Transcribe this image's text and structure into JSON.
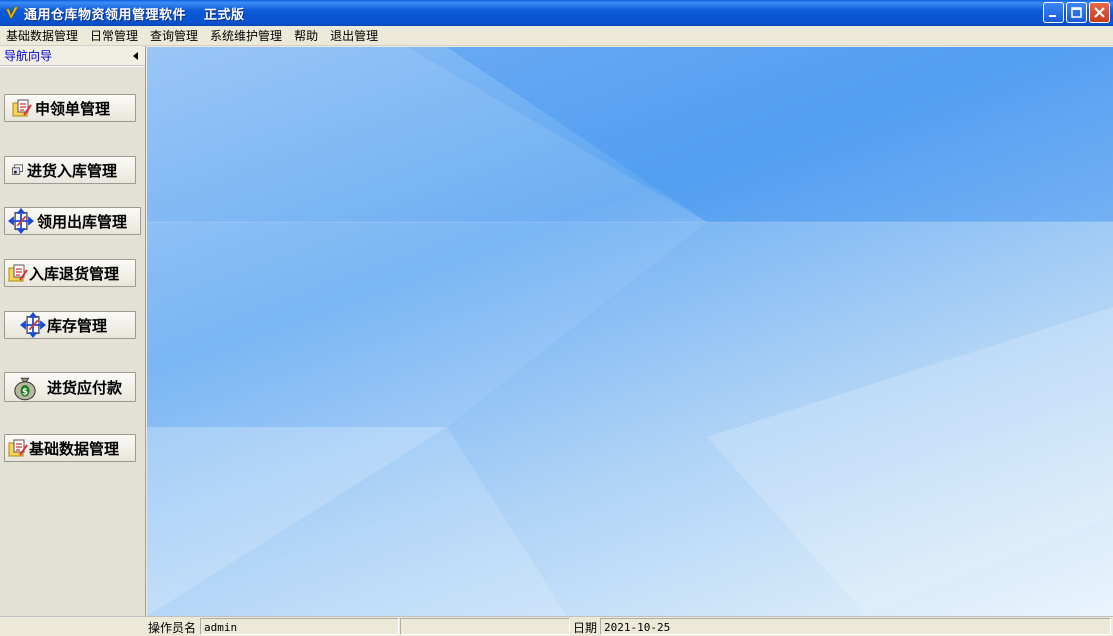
{
  "window": {
    "title": "通用仓库物资领用管理软件",
    "edition": "正式版"
  },
  "menu": {
    "items": [
      "基础数据管理",
      "日常管理",
      "查询管理",
      "系统维护管理",
      "帮助",
      "退出管理"
    ]
  },
  "sidebar": {
    "header": "导航向导",
    "buttons": [
      {
        "label": "申领单管理",
        "icon": "folder-edit-icon"
      },
      {
        "label": "进货入库管理",
        "icon": "cards-icon"
      },
      {
        "label": "领用出库管理",
        "icon": "arrows-cross-icon"
      },
      {
        "label": "入库退货管理",
        "icon": "folder-edit-icon"
      },
      {
        "label": "库存管理",
        "icon": "arrows-cross-icon"
      },
      {
        "label": "进货应付款",
        "icon": "money-bag-icon"
      },
      {
        "label": "基础数据管理",
        "icon": "folder-edit-icon"
      }
    ]
  },
  "status": {
    "operator_label": "操作员名",
    "operator_value": "admin",
    "date_label": "日期",
    "date_value": "2021-10-25"
  },
  "colors": {
    "titlebar": "#0a54d0",
    "background_blue": "#5ea6f2",
    "nav_header_text": "#0000cc"
  }
}
